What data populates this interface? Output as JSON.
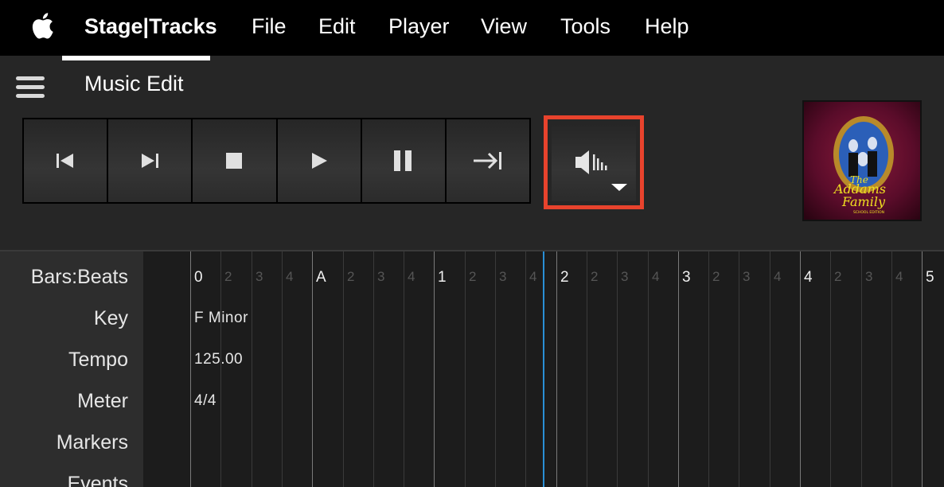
{
  "menubar": {
    "app_name": "Stage|Tracks",
    "items": [
      "File",
      "Edit",
      "Player",
      "View",
      "Tools",
      "Help"
    ]
  },
  "header": {
    "title": "Music Edit"
  },
  "transport": {
    "buttons": [
      "skip-back",
      "skip-forward",
      "stop",
      "play",
      "pause",
      "jump-to-end"
    ],
    "volume_button": "volume-icon"
  },
  "album_art": {
    "title_line1": "The",
    "title_line2": "Addams",
    "title_line3": "Family",
    "subtitle": "SCHOOL EDITION"
  },
  "timeline": {
    "rows": [
      "Bars:Beats",
      "Key",
      "Tempo",
      "Meter",
      "Markers",
      "Events"
    ],
    "key": "F Minor",
    "tempo": "125.00",
    "meter": "4/4",
    "beat_labels": [
      "0",
      "2",
      "3",
      "4",
      "A",
      "2",
      "3",
      "4",
      "1",
      "2",
      "3",
      "4",
      "2",
      "2",
      "3",
      "4",
      "3",
      "2",
      "3",
      "4",
      "4",
      "2",
      "3",
      "4",
      "5"
    ]
  },
  "colors": {
    "highlight": "#e8432d",
    "playhead": "#2a8fd6"
  }
}
